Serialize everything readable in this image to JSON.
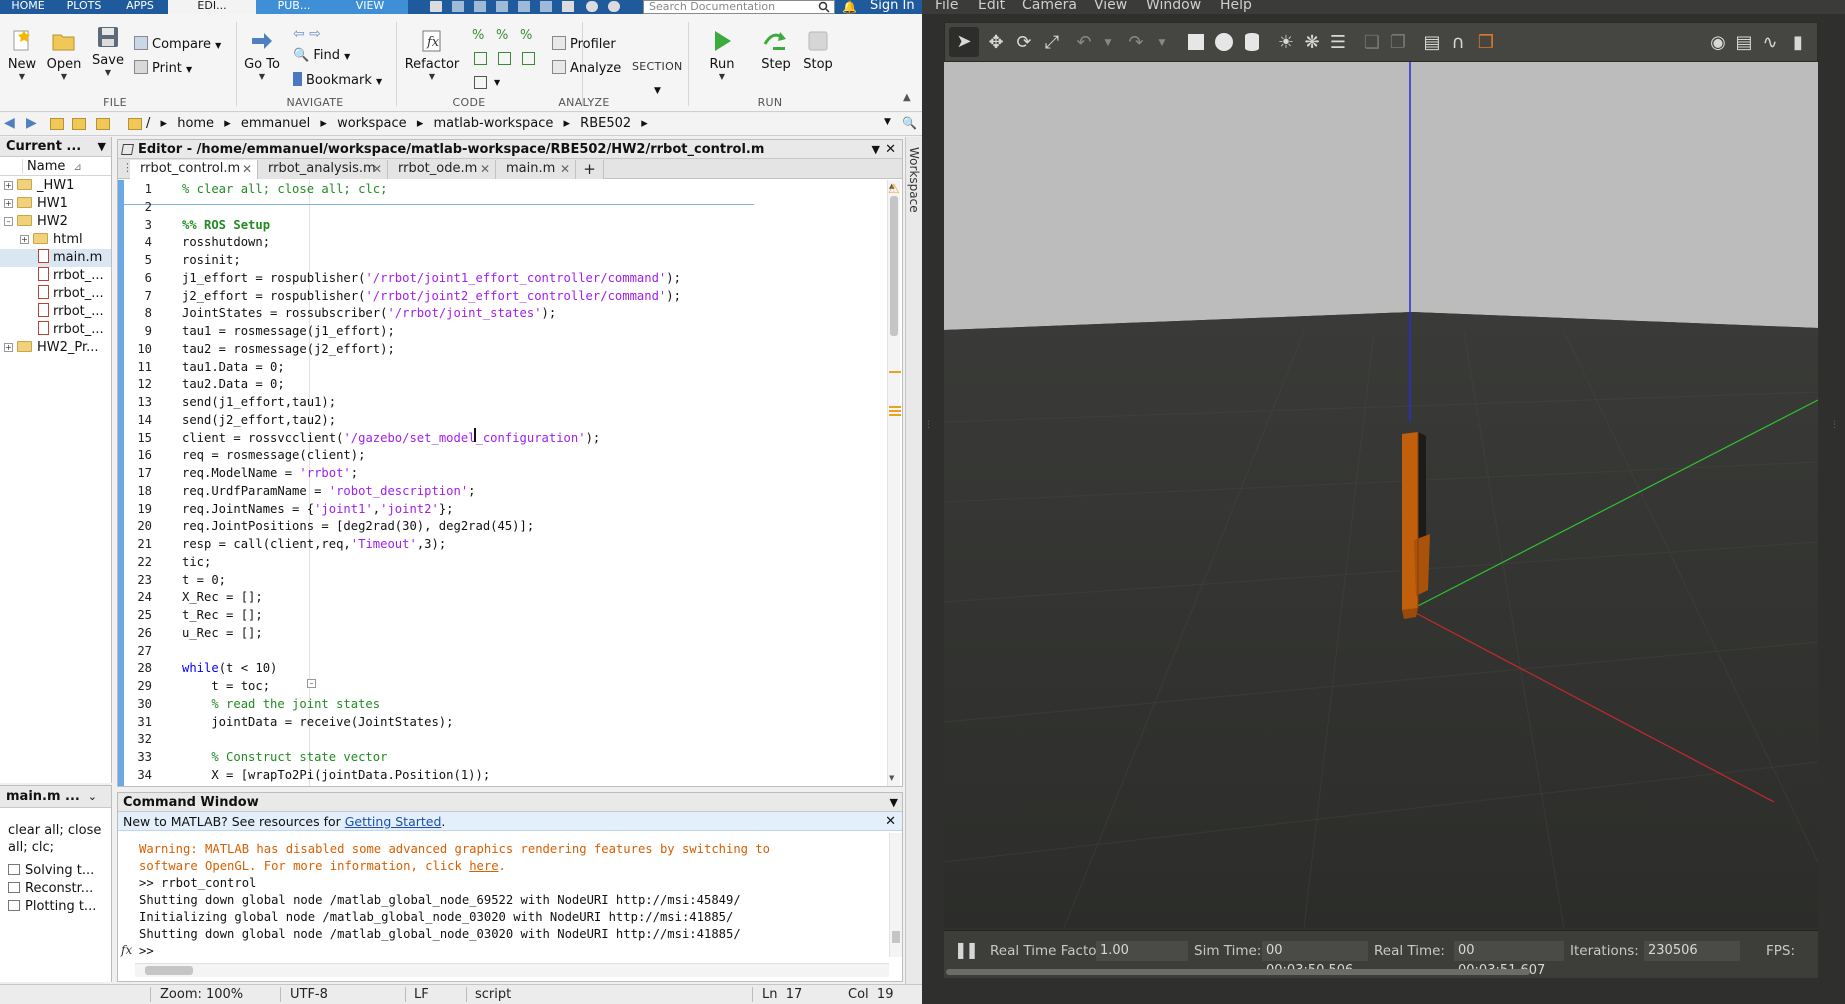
{
  "matlab": {
    "ribbon_tabs": [
      "HOME",
      "PLOTS",
      "APPS",
      "EDI...",
      "PUB...",
      "VIEW"
    ],
    "search_placeholder": "Search Documentation",
    "sign_in": "Sign In",
    "ribbon": {
      "file": {
        "new": "New",
        "open": "Open",
        "save": "Save",
        "compare": "Compare",
        "print": "Print",
        "label": "FILE"
      },
      "navigate": {
        "goto": "Go To",
        "find": "Find",
        "bookmark": "Bookmark",
        "label": "NAVIGATE"
      },
      "code": {
        "refactor": "Refactor",
        "label": "CODE"
      },
      "analyze": {
        "profiler": "Profiler",
        "analyze": "Analyze",
        "label": "ANALYZE"
      },
      "section": {
        "label": "SECTION"
      },
      "run": {
        "run": "Run",
        "step": "Step",
        "stop": "Stop",
        "label": "RUN"
      }
    },
    "path": [
      "/",
      "home",
      "emmanuel",
      "workspace",
      "matlab-workspace",
      "RBE502"
    ],
    "current_folder": {
      "title": "Current ...",
      "column_name": "Name",
      "items": [
        {
          "label": "_HW1",
          "type": "folder"
        },
        {
          "label": "HW1",
          "type": "folder"
        },
        {
          "label": "HW2",
          "type": "folder"
        },
        {
          "label": "html",
          "type": "folder"
        },
        {
          "label": "main.m",
          "type": "file"
        },
        {
          "label": "rrbot_...",
          "type": "file"
        },
        {
          "label": "rrbot_...",
          "type": "file"
        },
        {
          "label": "rrbot_...",
          "type": "file"
        },
        {
          "label": "rrbot_...",
          "type": "file"
        },
        {
          "label": "HW2_Pr...",
          "type": "folder"
        }
      ]
    },
    "details": {
      "title": "main.m ...",
      "description": "clear all; close all; clc;",
      "sections": [
        "Solving t...",
        "Reconstr...",
        "Plotting t..."
      ]
    },
    "editor": {
      "title": "Editor - /home/emmanuel/workspace/matlab-workspace/RBE502/HW2/rrbot_control.m",
      "tabs": [
        "rrbot_control.m",
        "rrbot_analysis.m",
        "rrbot_ode.m",
        "main.m"
      ],
      "lines": [
        {
          "n": "1",
          "t": "% clear all; close all; clc;"
        },
        {
          "n": "2",
          "t": ""
        },
        {
          "n": "3",
          "t": "%% ROS Setup"
        },
        {
          "n": "4",
          "t": "rosshutdown;"
        },
        {
          "n": "5",
          "t": "rosinit;"
        },
        {
          "n": "6",
          "t": "j1_effort = rospublisher('/rrbot/joint1_effort_controller/command');"
        },
        {
          "n": "7",
          "t": "j2_effort = rospublisher('/rrbot/joint2_effort_controller/command');"
        },
        {
          "n": "8",
          "t": "JointStates = rossubscriber('/rrbot/joint_states');"
        },
        {
          "n": "9",
          "t": "tau1 = rosmessage(j1_effort);"
        },
        {
          "n": "10",
          "t": "tau2 = rosmessage(j2_effort);"
        },
        {
          "n": "11",
          "t": "tau1.Data = 0;"
        },
        {
          "n": "12",
          "t": "tau2.Data = 0;"
        },
        {
          "n": "13",
          "t": "send(j1_effort,tau1);"
        },
        {
          "n": "14",
          "t": "send(j2_effort,tau2);"
        },
        {
          "n": "15",
          "t": "client = rossvcclient('/gazebo/set_model_configuration');"
        },
        {
          "n": "16",
          "t": "req = rosmessage(client);"
        },
        {
          "n": "17",
          "t": "req.ModelName = 'rrbot';"
        },
        {
          "n": "18",
          "t": "req.UrdfParamName = 'robot_description';"
        },
        {
          "n": "19",
          "t": "req.JointNames = {'joint1','joint2'};"
        },
        {
          "n": "20",
          "t": "req.JointPositions = [deg2rad(30), deg2rad(45)];"
        },
        {
          "n": "21",
          "t": "resp = call(client,req,'Timeout',3);"
        },
        {
          "n": "22",
          "t": "tic;"
        },
        {
          "n": "23",
          "t": "t = 0;"
        },
        {
          "n": "24",
          "t": "X_Rec = [];"
        },
        {
          "n": "25",
          "t": "t_Rec = [];"
        },
        {
          "n": "26",
          "t": "u_Rec = [];"
        },
        {
          "n": "27",
          "t": ""
        },
        {
          "n": "28",
          "t": "while(t < 10)"
        },
        {
          "n": "29",
          "t": "    t = toc;"
        },
        {
          "n": "30",
          "t": "    % read the joint states"
        },
        {
          "n": "31",
          "t": "    jointData = receive(JointStates);"
        },
        {
          "n": "32",
          "t": ""
        },
        {
          "n": "33",
          "t": "    % Construct state vector"
        },
        {
          "n": "34",
          "t": "    X = [wrapTo2Pi(jointData.Position(1));"
        }
      ]
    },
    "command_window": {
      "title": "Command Window",
      "banner_prefix": "New to MATLAB? See resources for ",
      "banner_link": "Getting Started",
      "banner_suffix": ".",
      "warning_1": "Warning: MATLAB has disabled some advanced graphics rendering features by switching to",
      "warning_2a": "software OpenGL. For more information, click ",
      "warning_link": "here",
      "warning_2b": ".",
      "output": [
        ">> rrbot_control",
        "Shutting down global node /matlab_global_node_69522 with NodeURI http://msi:45849/",
        "Initializing global node /matlab_global_node_03020 with NodeURI http://msi:41885/",
        "Shutting down global node /matlab_global_node_03020 with NodeURI http://msi:41885/"
      ],
      "prompt": ">>",
      "fx": "fx"
    },
    "status_bar": {
      "zoom": "Zoom: 100%",
      "encoding": "UTF-8",
      "eol": "LF",
      "type": "script",
      "ln_label": "Ln",
      "ln": "17",
      "col_label": "Col",
      "col": "19"
    },
    "workspace_strip": "Workspace"
  },
  "gazebo": {
    "menu": [
      "File",
      "Edit",
      "Camera",
      "View",
      "Window",
      "Help"
    ],
    "bottom": {
      "rtf_label": "Real Time Factor:",
      "rtf": "1.00",
      "sim_label": "Sim Time:",
      "sim": "00 00:03:50.506",
      "real_label": "Real Time:",
      "real": "00 00:03:51.607",
      "iter_label": "Iterations:",
      "iter": "230506",
      "fps_label": "FPS:"
    }
  },
  "colors": {
    "matlab_tab_bar": "#1f5a9c",
    "gazebo_ground": "#2f302d",
    "gazebo_sky": "#bcbcbc",
    "robot_link": "#c15f0c",
    "axis_x": "#c8282c",
    "axis_y": "#2fc02f",
    "axis_z": "#2a2ad8"
  }
}
